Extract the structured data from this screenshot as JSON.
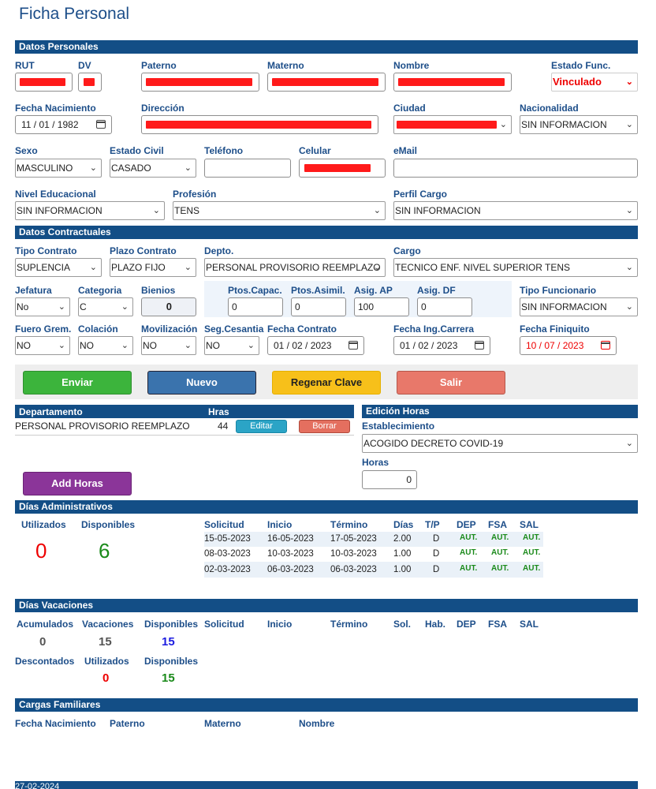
{
  "page_title": "Ficha Personal",
  "sections": {
    "personales": "Datos Personales",
    "contractuales": "Datos Contractuales",
    "administrativos": "Días Administrativos",
    "vacaciones": "Días Vacaciones",
    "cargas": "Cargas Familiares"
  },
  "personal": {
    "rut_label": "RUT",
    "dv_label": "DV",
    "paterno_label": "Paterno",
    "materno_label": "Materno",
    "nombre_label": "Nombre",
    "estado_label": "Estado Func.",
    "estado_value": "Vinculado",
    "fnac_label": "Fecha Nacimiento",
    "fnac_value": "11 / 01 / 1982",
    "direccion_label": "Dirección",
    "ciudad_label": "Ciudad",
    "nacionalidad_label": "Nacionalidad",
    "nacionalidad_value": "SIN INFORMACION",
    "sexo_label": "Sexo",
    "sexo_value": "MASCULINO",
    "civil_label": "Estado Civil",
    "civil_value": "CASADO",
    "telefono_label": "Teléfono",
    "telefono_value": "",
    "celular_label": "Celular",
    "email_label": "eMail",
    "email_value": "",
    "nivel_label": "Nivel Educacional",
    "nivel_value": "SIN INFORMACION",
    "profesion_label": "Profesión",
    "profesion_value": "TENS",
    "perfil_label": "Perfil Cargo",
    "perfil_value": "SIN INFORMACION"
  },
  "contract": {
    "tipo_label": "Tipo Contrato",
    "tipo_value": "SUPLENCIA",
    "plazo_label": "Plazo Contrato",
    "plazo_value": "PLAZO FIJO",
    "depto_label": "Depto.",
    "depto_value": "PERSONAL PROVISORIO REEMPLAZO",
    "cargo_label": "Cargo",
    "cargo_value": "TECNICO ENF. NIVEL SUPERIOR TENS",
    "jefatura_label": "Jefatura",
    "jefatura_value": "No",
    "categoria_label": "Categoria",
    "categoria_value": "C",
    "bienios_label": "Bienios",
    "bienios_value": "0",
    "capac_label": "Ptos.Capac.",
    "capac_value": "0",
    "asimil_label": "Ptos.Asimil.",
    "asimil_value": "0",
    "ap_label": "Asig. AP",
    "ap_value": "100",
    "df_label": "Asig. DF",
    "df_value": "0",
    "tipofunc_label": "Tipo Funcionario",
    "tipofunc_value": "SIN INFORMACION",
    "fuero_label": "Fuero Grem.",
    "fuero_value": "NO",
    "colacion_label": "Colación",
    "colacion_value": "NO",
    "movil_label": "Movilización",
    "movil_value": "NO",
    "cesantia_label": "Seg.Cesantia",
    "cesantia_value": "NO",
    "fcontrato_label": "Fecha Contrato",
    "fcontrato_value": "01 / 02 / 2023",
    "fcarrera_label": "Fecha Ing.Carrera",
    "fcarrera_value": "01 / 02 / 2023",
    "ffiniquito_label": "Fecha Finiquito",
    "ffiniquito_value": "10 / 07 / 2023"
  },
  "buttons": {
    "enviar": "Enviar",
    "nuevo": "Nuevo",
    "regenerar": "Regenar Clave",
    "salir": "Salir",
    "add_horas": "Add Horas",
    "editar": "Editar",
    "borrar": "Borrar"
  },
  "dept_table": {
    "col_departamento": "Departamento",
    "col_hras": "Hras",
    "row_name": "PERSONAL PROVISORIO REEMPLAZO",
    "row_hras": "44"
  },
  "horas_panel": {
    "title": "Edición Horas",
    "establecimiento_label": "Establecimiento",
    "establecimiento_value": "ACOGIDO DECRETO COVID-19",
    "horas_label": "Horas",
    "horas_value": "0"
  },
  "admin": {
    "utilizados_label": "Utilizados",
    "utilizados_value": "0",
    "disponibles_label": "Disponibles",
    "disponibles_value": "6",
    "headers": [
      "Solicitud",
      "Inicio",
      "Término",
      "Días",
      "T/P",
      "DEP",
      "FSA",
      "SAL"
    ],
    "rows": [
      [
        "15-05-2023",
        "16-05-2023",
        "17-05-2023",
        "2.00",
        "D",
        "AUT.",
        "AUT.",
        "AUT."
      ],
      [
        "08-03-2023",
        "10-03-2023",
        "10-03-2023",
        "1.00",
        "D",
        "AUT.",
        "AUT.",
        "AUT."
      ],
      [
        "02-03-2023",
        "06-03-2023",
        "06-03-2023",
        "1.00",
        "D",
        "AUT.",
        "AUT.",
        "AUT."
      ]
    ]
  },
  "vac": {
    "acumulados_label": "Acumulados",
    "acumulados_value": "0",
    "vacaciones_label": "Vacaciones",
    "vacaciones_value": "15",
    "disponibles_label": "Disponibles",
    "disponibles_value": "15",
    "descontados_label": "Descontados",
    "utilizados_label": "Utilizados",
    "utilizados_value": "0",
    "disponibles2_label": "Disponibles",
    "disponibles2_value": "15",
    "headers": [
      "Solicitud",
      "Inicio",
      "Término",
      "Sol.",
      "Hab.",
      "DEP",
      "FSA",
      "SAL"
    ]
  },
  "cargas": {
    "headers": [
      "Fecha Nacimiento",
      "Paterno",
      "Materno",
      "Nombre"
    ]
  },
  "footer": {
    "date": "27-02-2024"
  }
}
